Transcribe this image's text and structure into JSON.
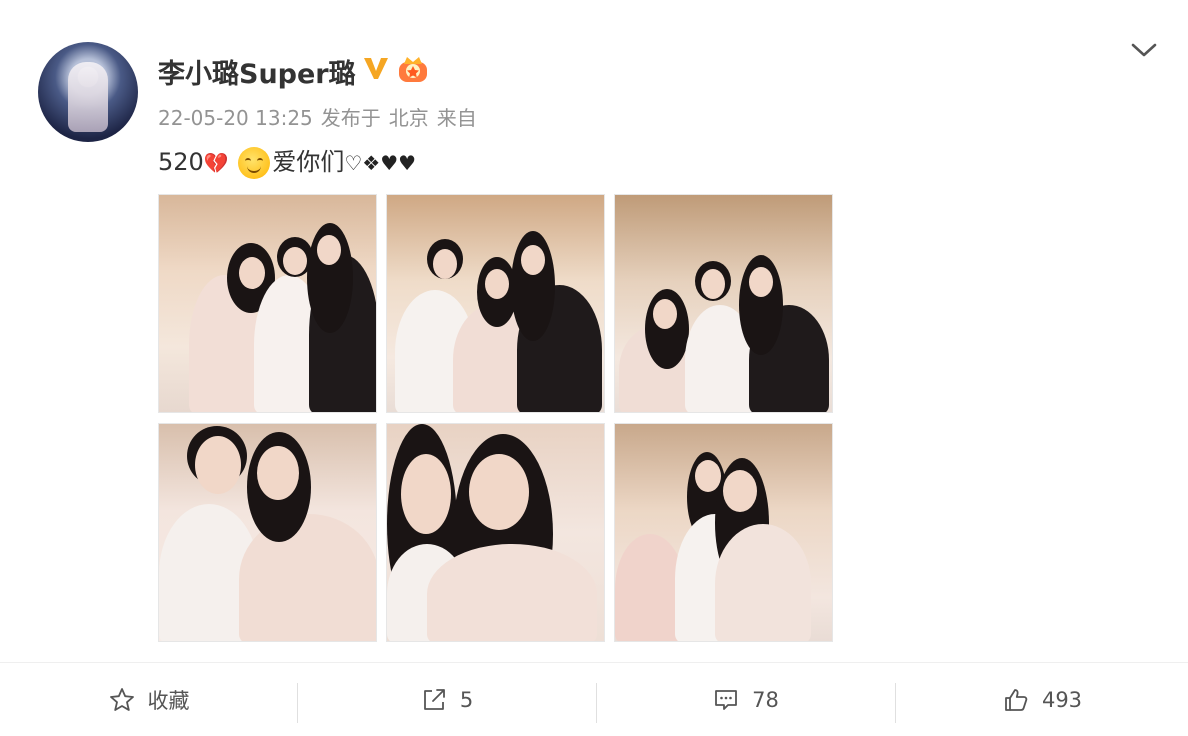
{
  "user": {
    "name": "李小璐Super璐"
  },
  "post": {
    "date": "22-05-20 13:25",
    "published_label": "发布于",
    "location": "北京",
    "source_label": "来自",
    "text_prefix": "520",
    "text_main": "爱你们"
  },
  "icons": {
    "verified": "verified-v-icon",
    "crown": "member-crown-icon",
    "more": "chevron-down-icon",
    "favorite": "star-icon",
    "share": "share-icon",
    "comment": "comment-icon",
    "like": "thumbs-up-icon"
  },
  "actions": {
    "favorite_label": "收藏",
    "share_count": "5",
    "comment_count": "78",
    "like_count": "493"
  },
  "colors": {
    "verified": "#f5a623",
    "text_primary": "#333333",
    "text_meta": "#939393"
  }
}
